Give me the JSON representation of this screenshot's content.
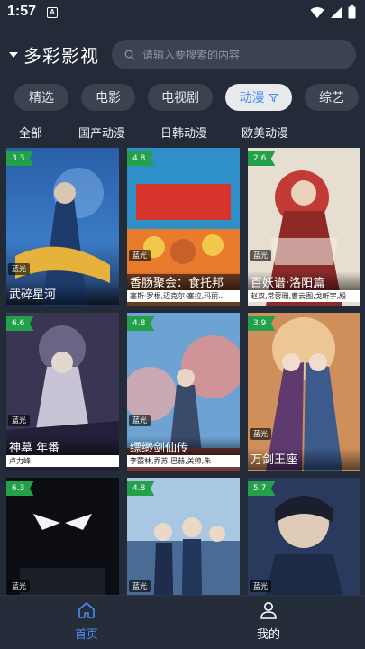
{
  "status": {
    "time": "1:57",
    "notif_letter": "A"
  },
  "brand": {
    "title": "多彩影视"
  },
  "search": {
    "placeholder": "请输入要搜索的内容"
  },
  "categories": [
    {
      "label": "精选",
      "active": false
    },
    {
      "label": "电影",
      "active": false
    },
    {
      "label": "电视剧",
      "active": false
    },
    {
      "label": "动漫",
      "active": true
    },
    {
      "label": "综艺",
      "active": false
    }
  ],
  "subtabs": [
    "全部",
    "国产动漫",
    "日韩动漫",
    "欧美动漫"
  ],
  "cards": [
    {
      "score": "3.3",
      "quality": "蓝光",
      "title": "武碎星河",
      "actors": ""
    },
    {
      "score": "4.8",
      "quality": "蓝光",
      "title": "香肠聚会：食托邦",
      "actors": "塞斯·罗根,迈克尔·塞拉,玛丽..."
    },
    {
      "score": "2.6",
      "quality": "蓝光",
      "title": "百妖谱·洛阳篇",
      "actors": "赵双,常蓉珊,曹云图,戈昕宇,殿"
    },
    {
      "score": "6.6",
      "quality": "蓝光",
      "title": "神墓 年番",
      "actors": "卢力峰"
    },
    {
      "score": "4.8",
      "quality": "蓝光",
      "title": "缥缈剑仙传",
      "actors": "李囍林,乔苏,巴赫,关帅,朱"
    },
    {
      "score": "3.9",
      "quality": "蓝光",
      "title": "万剑王座",
      "actors": ""
    },
    {
      "score": "6.3",
      "quality": "蓝光",
      "title": "",
      "actors": ""
    },
    {
      "score": "4.8",
      "quality": "蓝光",
      "title": "",
      "actors": ""
    },
    {
      "score": "5.7",
      "quality": "蓝光",
      "title": "",
      "actors": ""
    }
  ],
  "nav": {
    "home": "首页",
    "mine": "我的"
  },
  "colors": {
    "accent": "#4a8ff0",
    "score_badge": "#22a04a",
    "background": "#232a38"
  }
}
